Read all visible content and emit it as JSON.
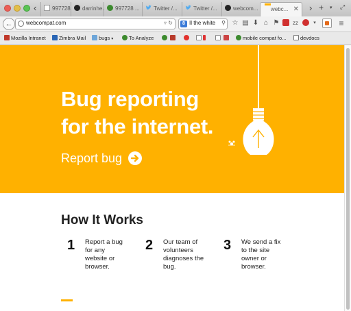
{
  "browser": {
    "tabs": [
      {
        "label": "997728 ...",
        "icon": "generic-page-icon"
      },
      {
        "label": "darrinhe...",
        "icon": "github-icon"
      },
      {
        "label": "997728 ...",
        "icon": "bugzilla-icon"
      },
      {
        "label": "Twitter /...",
        "icon": "twitter-icon"
      },
      {
        "label": "Twitter /...",
        "icon": "twitter-icon"
      },
      {
        "label": "webcom...",
        "icon": "github-icon"
      },
      {
        "label": "webc...",
        "icon": "webcompat-icon"
      }
    ],
    "url": "webcompat.com",
    "search_engine_label": "8",
    "search_text": "Il the white",
    "bookmarks": [
      {
        "label": "Mozilla Intranet",
        "icon": "mozilla-icon"
      },
      {
        "label": "Zimbra Mail",
        "icon": "zimbra-icon"
      },
      {
        "label": "bugs",
        "icon": "folder-icon"
      },
      {
        "label": "To Analyze",
        "icon": "bugzilla-icon"
      },
      {
        "label": "mobile compat fo...",
        "icon": "bugzilla-icon"
      },
      {
        "label": "devdocs",
        "icon": "devdocs-icon"
      }
    ],
    "colors": {
      "accent": "#ffb100",
      "twitter": "#55acee"
    }
  },
  "page": {
    "hero": {
      "title_line1": "Bug reporting",
      "title_line2": "for the internet.",
      "report_bug": "Report bug"
    },
    "how": {
      "title": "How It Works",
      "steps": [
        {
          "num": "1",
          "line1": "Report a bug",
          "line2": "for any",
          "line3": "website or",
          "line4": "browser."
        },
        {
          "num": "2",
          "line1": "Our team of",
          "line2": "volunteers",
          "line3": "diagnoses the",
          "line4": "bug."
        },
        {
          "num": "3",
          "line1": "We send a fix",
          "line2": "to the site",
          "line3": "owner or",
          "line4": "browser."
        }
      ]
    }
  }
}
